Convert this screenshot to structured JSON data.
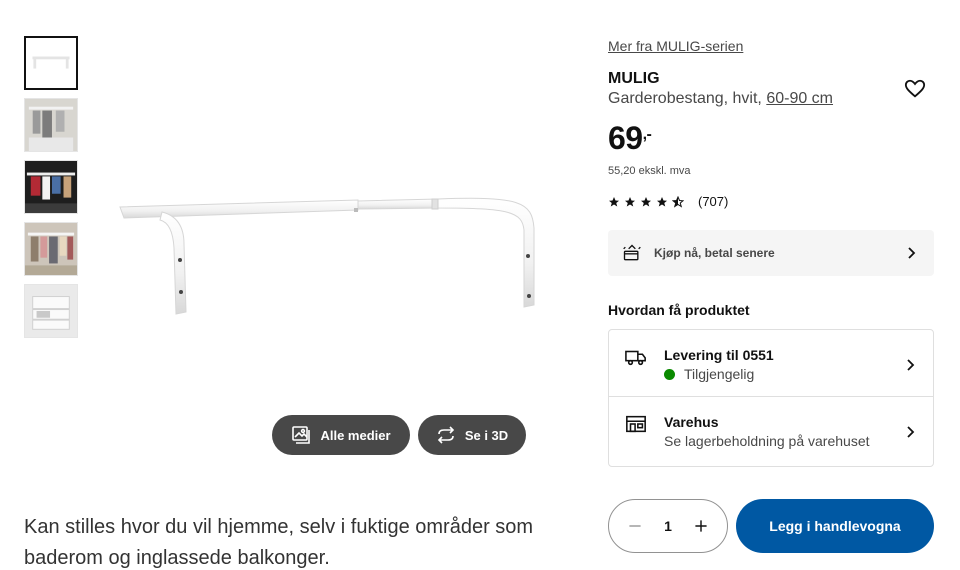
{
  "gallery": {
    "thumbnails": [
      "thumbnail-rod",
      "thumbnail-bathroom",
      "thumbnail-closet-dark",
      "thumbnail-closet-clothes",
      "thumbnail-shelf"
    ],
    "buttons": {
      "all_media": "Alle medier",
      "view_3d": "Se i 3D"
    }
  },
  "description": "Kan stilles hvor du vil hjemme, selv i fuktige områder som baderom og inglassede balkonger.",
  "product": {
    "series_link": "Mer fra MULIG-serien",
    "name": "MULIG",
    "type": "Garderobestang, hvit, ",
    "size": "60-90 cm",
    "price_main": "69",
    "price_decimal": ",-",
    "price_ex_vat": "55,20 ekskl. mva",
    "rating": 4.5,
    "rating_count": "(707)"
  },
  "bnpl": {
    "label": "Kjøp nå, betal senere"
  },
  "delivery": {
    "title": "Hvordan få produktet",
    "home": {
      "title": "Levering til 0551",
      "status": "Tilgjengelig",
      "status_color": "#0a8a00"
    },
    "store": {
      "title": "Varehus",
      "subtitle": "Se lagerbeholdning på varehuset"
    }
  },
  "cart": {
    "quantity": "1",
    "add_label": "Legg i handlevogna",
    "accent": "#0058a3"
  }
}
